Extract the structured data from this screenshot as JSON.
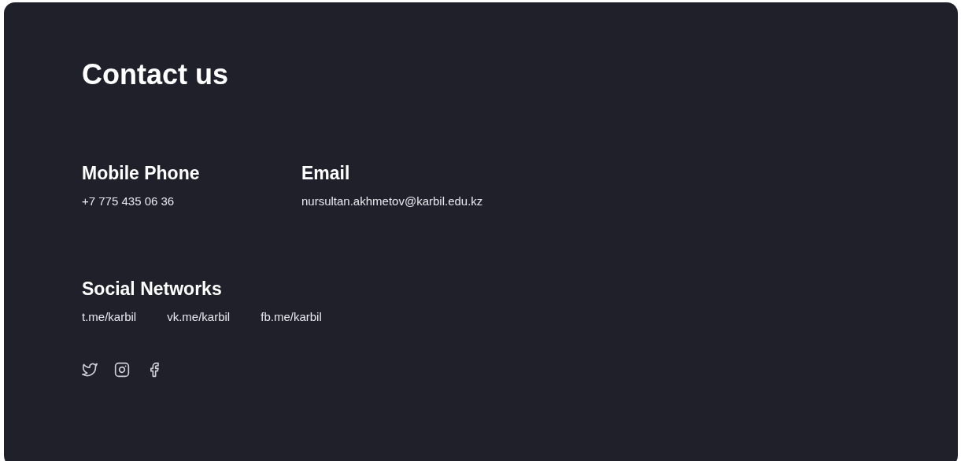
{
  "title": "Contact us",
  "contacts": [
    {
      "label": "Mobile Phone",
      "value": "+7 775 435 06 36"
    },
    {
      "label": "Email",
      "value": "nursultan.akhmetov@karbil.edu.kz"
    }
  ],
  "social": {
    "label": "Social Networks",
    "links": [
      "t.me/karbil",
      "vk.me/karbil",
      "fb.me/karbil"
    ],
    "icons": [
      {
        "kind": "twitter"
      },
      {
        "kind": "instagram"
      },
      {
        "kind": "facebook"
      }
    ]
  }
}
